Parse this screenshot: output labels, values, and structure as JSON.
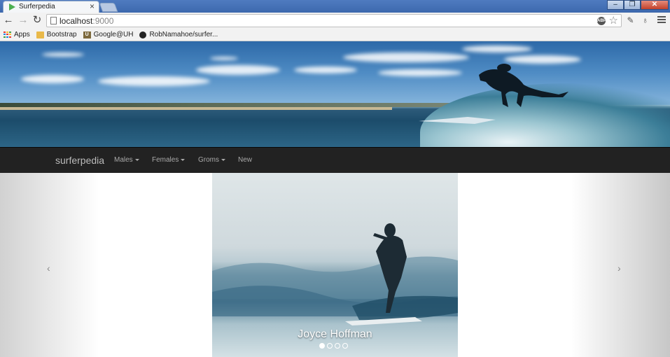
{
  "browser": {
    "tab_title": "Surferpedia",
    "tab_close": "×",
    "url_host": "localhost",
    "url_port": ":9000",
    "adblock_label": "ABP",
    "window_buttons": [
      "–",
      "❐",
      "✕"
    ]
  },
  "bookmarks": [
    {
      "label": "Apps",
      "icon": "apps-icon"
    },
    {
      "label": "Bootstrap",
      "icon": "folder-icon"
    },
    {
      "label": "Google@UH",
      "icon": "uh-icon"
    },
    {
      "label": "RobNamahoe/surfer...",
      "icon": "github-icon"
    }
  ],
  "navbar": {
    "brand": "surferpedia",
    "items": [
      "Males",
      "Females",
      "Groms",
      "New"
    ]
  },
  "carousel": {
    "caption": "Joyce Hoffman",
    "prev_label": "‹",
    "next_label": "›",
    "indicator_count": 4,
    "active_index": 0
  },
  "colors": {
    "navbar_bg": "#222222",
    "nav_text": "#a9a9a9",
    "brand_text": "#bbbbbb"
  }
}
